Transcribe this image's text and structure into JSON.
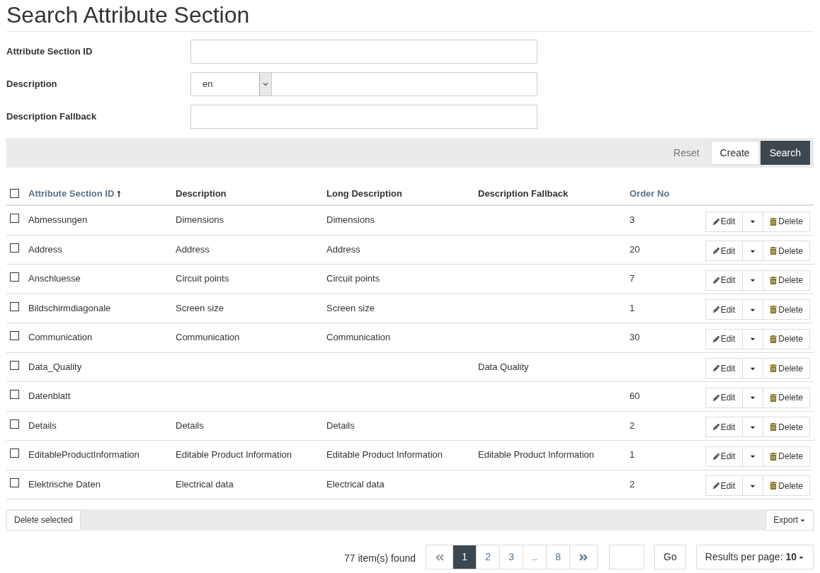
{
  "title": "Search Attribute Section",
  "form": [
    {
      "label": "Attribute Section ID",
      "kind": "text"
    },
    {
      "label": "Description",
      "kind": "lang",
      "language": "en"
    },
    {
      "label": "Description Fallback",
      "kind": "text"
    }
  ],
  "toolbar": {
    "reset": "Reset",
    "create": "Create",
    "search": "Search"
  },
  "table": {
    "select_all_checked": false,
    "columns": [
      {
        "label": "Attribute Section ID",
        "sortable": true,
        "sorted": true
      },
      {
        "label": "Description",
        "sortable": false,
        "sorted": false
      },
      {
        "label": "Long Description",
        "sortable": false,
        "sorted": false
      },
      {
        "label": "Description Fallback",
        "sortable": false,
        "sorted": false
      },
      {
        "label": "Order No",
        "sortable": true,
        "sorted": false
      }
    ],
    "rows": [
      {
        "checked": false,
        "cells": [
          "Abmessungen",
          "Dimensions",
          "Dimensions",
          "",
          "3"
        ],
        "edit": "Edit",
        "delete": "Delete"
      },
      {
        "checked": false,
        "cells": [
          "Address",
          "Address",
          "Address",
          "",
          "20"
        ],
        "edit": "Edit",
        "delete": "Delete"
      },
      {
        "checked": false,
        "cells": [
          "Anschluesse",
          "Circuit points",
          "Circuit points",
          "",
          "7"
        ],
        "edit": "Edit",
        "delete": "Delete"
      },
      {
        "checked": false,
        "cells": [
          "Bildschirmdiagonale",
          "Screen size",
          "Screen size",
          "",
          "1"
        ],
        "edit": "Edit",
        "delete": "Delete"
      },
      {
        "checked": false,
        "cells": [
          "Communication",
          "Communication",
          "Communication",
          "",
          "30"
        ],
        "edit": "Edit",
        "delete": "Delete"
      },
      {
        "checked": false,
        "cells": [
          "Data_Quality",
          "",
          "",
          "Data Quality",
          ""
        ],
        "edit": "Edit",
        "delete": "Delete"
      },
      {
        "checked": false,
        "cells": [
          "Datenblatt",
          "",
          "",
          "",
          "60"
        ],
        "edit": "Edit",
        "delete": "Delete"
      },
      {
        "checked": false,
        "cells": [
          "Details",
          "Details",
          "Details",
          "",
          "2"
        ],
        "edit": "Edit",
        "delete": "Delete"
      },
      {
        "checked": false,
        "cells": [
          "EditableProductInformation",
          "Editable Product Information",
          "Editable Product Information",
          "Editable Product Information",
          "1"
        ],
        "edit": "Edit",
        "delete": "Delete"
      },
      {
        "checked": false,
        "cells": [
          "Elektrische Daten",
          "Electrical data",
          "Electrical data",
          "",
          "2"
        ],
        "edit": "Edit",
        "delete": "Delete"
      }
    ]
  },
  "footer": {
    "delete_selected": "Delete selected",
    "export": "Export"
  },
  "pagination": {
    "found": "77 item(s) found",
    "pages": [
      {
        "label": "1",
        "selected": true
      },
      {
        "label": "2",
        "selected": false
      },
      {
        "label": "3",
        "selected": false
      },
      {
        "label": "..",
        "selected": false
      },
      {
        "label": "8",
        "selected": false
      }
    ],
    "go": "Go",
    "per_page": "Results per page: **10**"
  }
}
